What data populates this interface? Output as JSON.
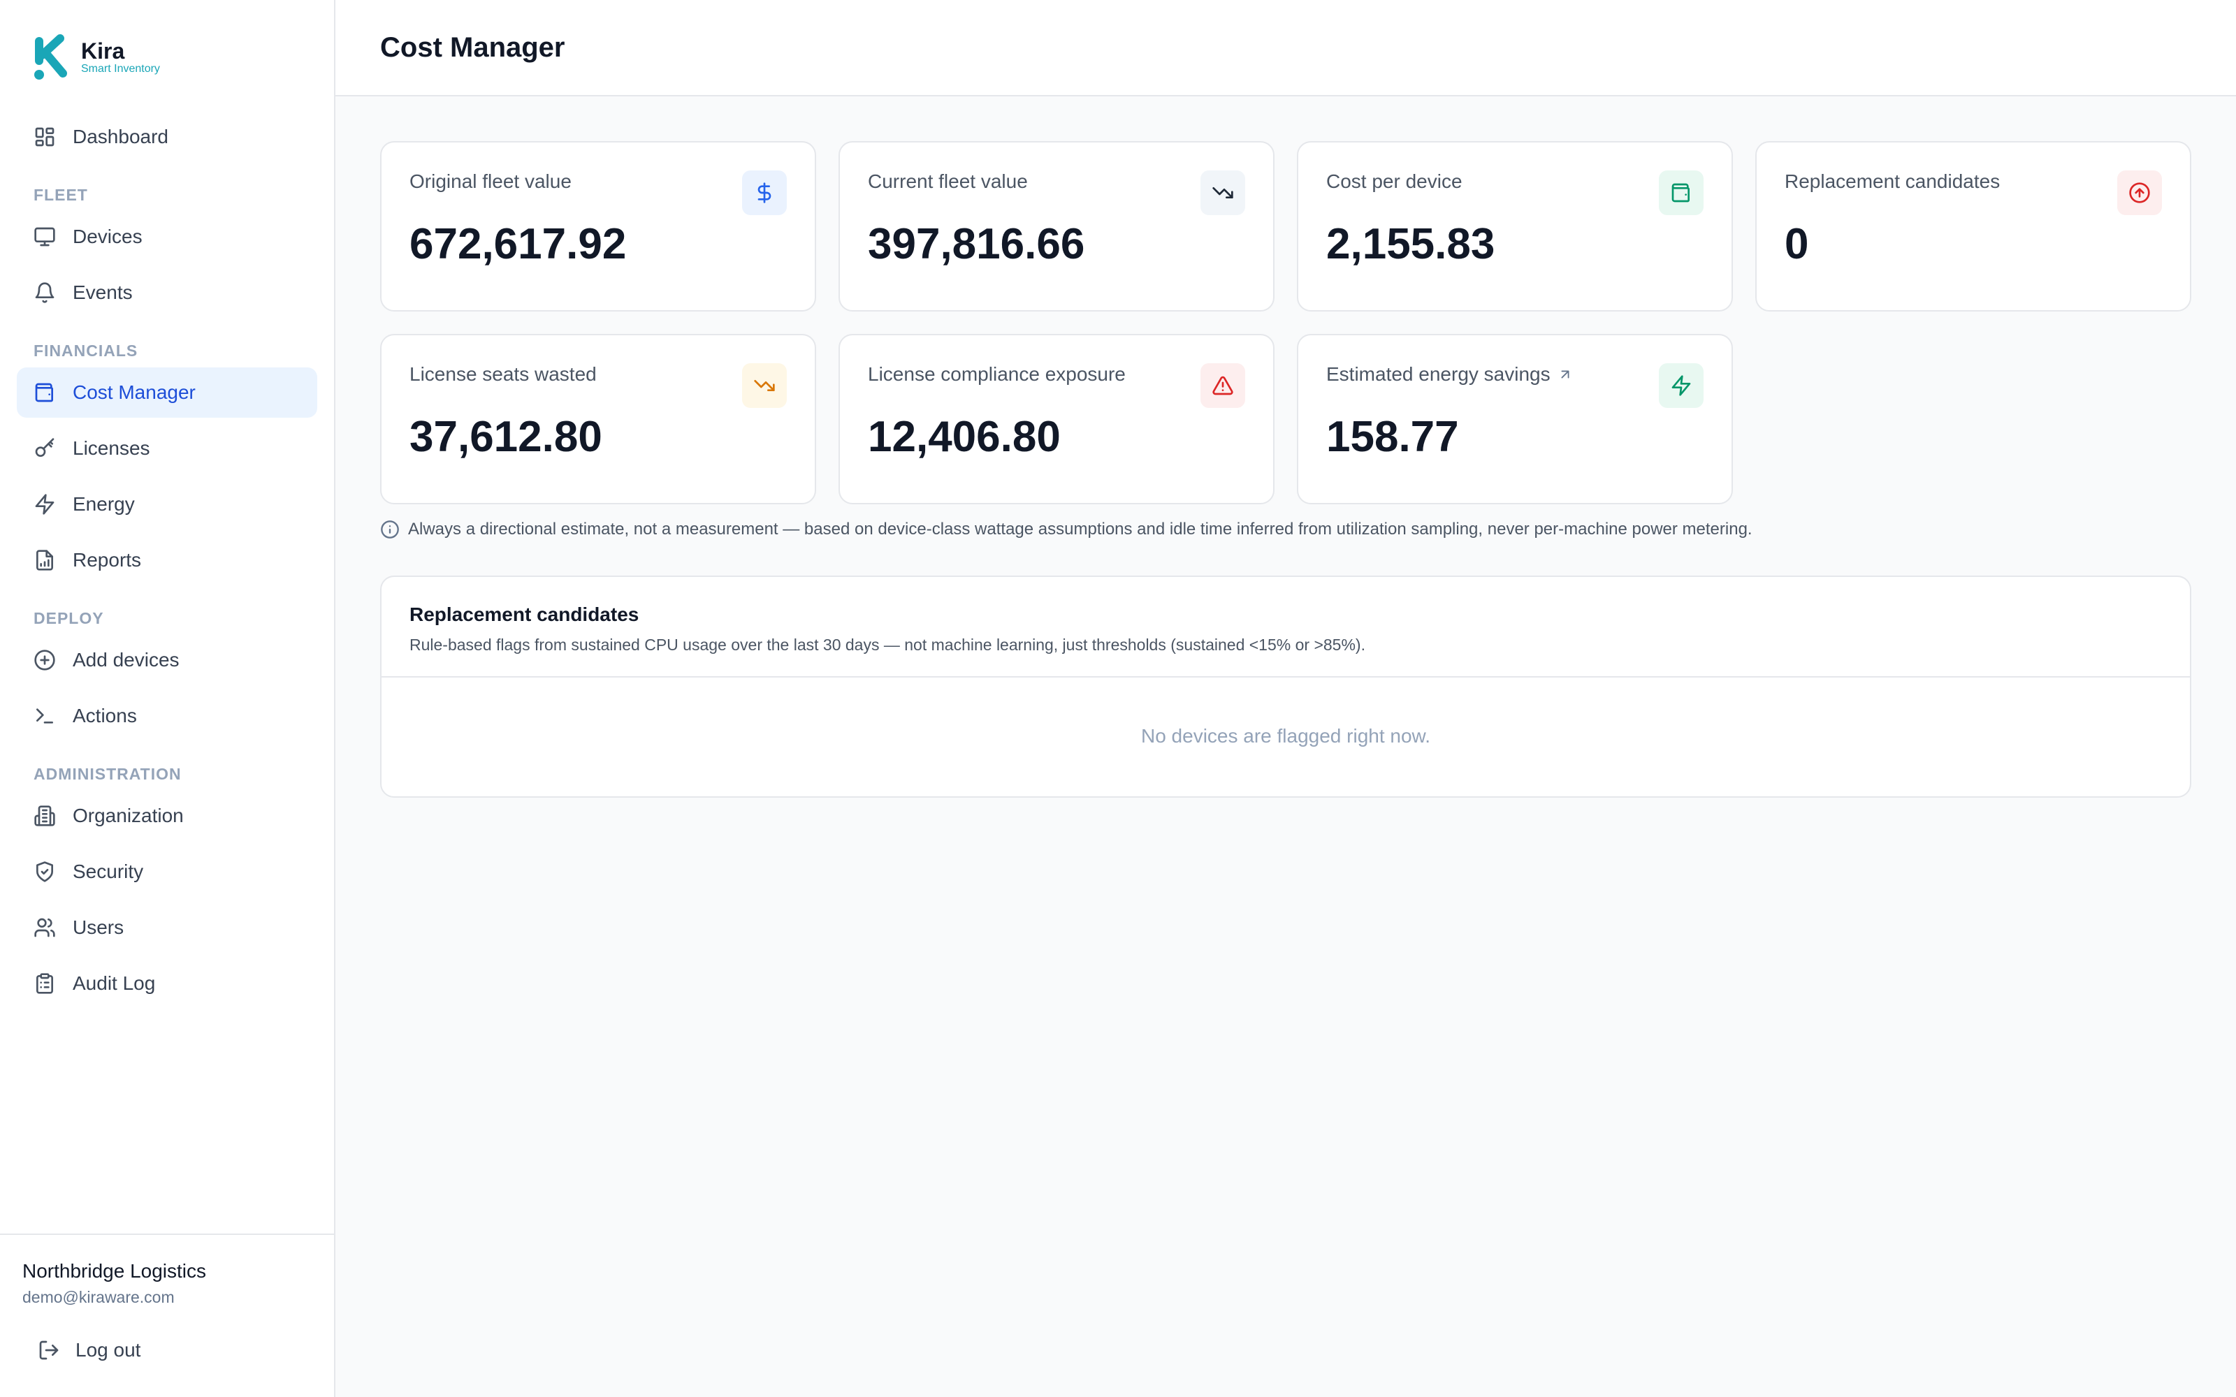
{
  "brand": {
    "name": "Kira",
    "tagline": "Smart Inventory",
    "accent": "#1aa6b7"
  },
  "page": {
    "title": "Cost Manager"
  },
  "nav": {
    "dashboard": "Dashboard",
    "sections": {
      "fleet": "FLEET",
      "financials": "FINANCIALS",
      "deploy": "DEPLOY",
      "administration": "ADMINISTRATION"
    },
    "devices": "Devices",
    "events": "Events",
    "cost_manager": "Cost Manager",
    "licenses": "Licenses",
    "energy": "Energy",
    "reports": "Reports",
    "add_devices": "Add devices",
    "actions": "Actions",
    "organization": "Organization",
    "security": "Security",
    "users": "Users",
    "audit_log": "Audit Log"
  },
  "account": {
    "org": "Northbridge Logistics",
    "email": "demo@kiraware.com",
    "logout": "Log out"
  },
  "cards": [
    {
      "label": "Original fleet value",
      "value": "672,617.92",
      "icon": "dollar-icon",
      "color": "#2563eb",
      "bg": "#eaf2fe"
    },
    {
      "label": "Current fleet value",
      "value": "397,816.66",
      "icon": "trending-down-icon",
      "color": "#1f2937",
      "bg": "#f1f5f9"
    },
    {
      "label": "Cost per device",
      "value": "2,155.83",
      "icon": "wallet-icon",
      "color": "#059669",
      "bg": "#e8f8f1"
    },
    {
      "label": "Replacement candidates",
      "value": "0",
      "icon": "arrow-up-circle-icon",
      "color": "#dc2626",
      "bg": "#fdeeee"
    },
    {
      "label": "License seats wasted",
      "value": "37,612.80",
      "icon": "trending-down-icon",
      "color": "#d97706",
      "bg": "#fef7e6"
    },
    {
      "label": "License compliance exposure",
      "value": "12,406.80",
      "icon": "alert-triangle-icon",
      "color": "#dc2626",
      "bg": "#fdeeee"
    },
    {
      "label": "Estimated energy savings",
      "value": "158.77",
      "icon": "zap-icon",
      "color": "#059669",
      "bg": "#e8f8f1"
    }
  ],
  "note": "Always a directional estimate, not a measurement — based on device-class wattage assumptions and idle time inferred from utilization sampling, never per-machine power metering.",
  "panel": {
    "title": "Replacement candidates",
    "subtitle": "Rule-based flags from sustained CPU usage over the last 30 days — not machine learning, just thresholds (sustained <15% or >85%).",
    "empty": "No devices are flagged right now."
  }
}
